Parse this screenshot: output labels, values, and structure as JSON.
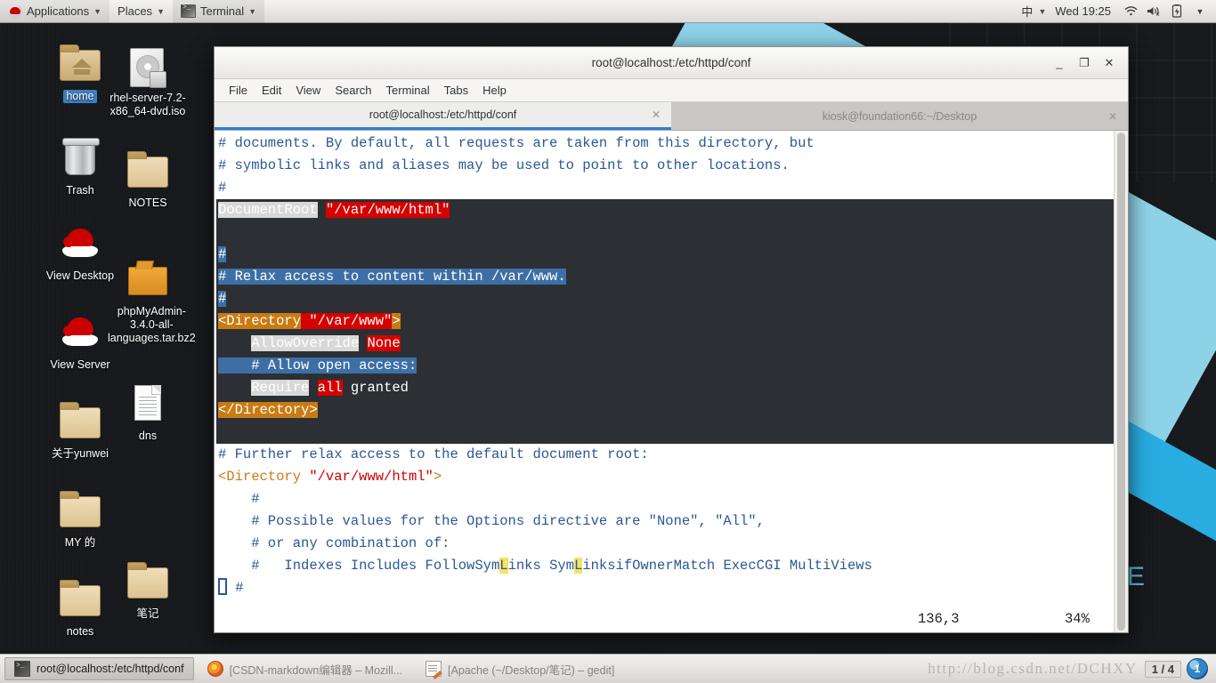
{
  "top_panel": {
    "applications": "Applications",
    "places": "Places",
    "active_app": "Terminal",
    "caret": "▼",
    "ime": "中",
    "clock": "Wed 19:25",
    "icons": {
      "wifi": "wifi-icon",
      "volume": "volume-muted-icon",
      "battery": "battery-icon",
      "menu_caret": "▼"
    }
  },
  "desktop": {
    "wallpaper_text": "SE",
    "icons": [
      {
        "label": "home",
        "type": "folder-home",
        "selected": true
      },
      {
        "label": "rhel-server-7.2-x86_64-dvd.iso",
        "type": "disc"
      },
      {
        "label": "Trash",
        "type": "trash"
      },
      {
        "label": "NOTES",
        "type": "folder"
      },
      {
        "label": "View Desktop",
        "type": "redhat"
      },
      {
        "label": "phpMyAdmin-3.4.0-all-languages.tar.bz2",
        "type": "archive"
      },
      {
        "label": "View Server",
        "type": "redhat"
      },
      {
        "label": "关于yunwei",
        "type": "folder"
      },
      {
        "label": "dns",
        "type": "document"
      },
      {
        "label": "MY 的",
        "type": "folder"
      },
      {
        "label": "笔记",
        "type": "folder"
      },
      {
        "label": "notes",
        "type": "folder"
      }
    ]
  },
  "terminal": {
    "title": "root@localhost:/etc/httpd/conf",
    "window_buttons": {
      "minimize": "_",
      "maximize": "❐",
      "close": "✕"
    },
    "menu": [
      "File",
      "Edit",
      "View",
      "Search",
      "Terminal",
      "Tabs",
      "Help"
    ],
    "tabs": [
      {
        "label": "root@localhost:/etc/httpd/conf",
        "active": true,
        "close": "✕"
      },
      {
        "label": "kiosk@foundation66:~/Desktop",
        "active": false,
        "close": "✕"
      }
    ],
    "status": {
      "position": "136,3",
      "percent": "34%"
    },
    "lines": [
      {
        "bg": "white",
        "segs": [
          {
            "t": "# documents. By default, all requests are taken from this directory, but",
            "s": "fg-blue"
          }
        ]
      },
      {
        "bg": "white",
        "segs": [
          {
            "t": "# symbolic links and aliases may be used to point to other locations.",
            "s": "fg-blue"
          }
        ]
      },
      {
        "bg": "white",
        "segs": [
          {
            "t": "#",
            "s": "fg-blue"
          }
        ]
      },
      {
        "bg": "dark",
        "segs": [
          {
            "t": "DocumentRoot",
            "s": "bg-grey"
          },
          {
            "t": " ",
            "s": "bg-dark"
          },
          {
            "t": "\"/var/www/html\"",
            "s": "bg-red"
          }
        ]
      },
      {
        "bg": "dark",
        "segs": [
          {
            "t": "",
            "s": "bg-dark"
          }
        ]
      },
      {
        "bg": "dark",
        "segs": [
          {
            "t": "#",
            "s": "bg-blue"
          }
        ]
      },
      {
        "bg": "dark",
        "segs": [
          {
            "t": "# Relax access to content within /var/www.",
            "s": "bg-blue"
          }
        ]
      },
      {
        "bg": "dark",
        "segs": [
          {
            "t": "#",
            "s": "bg-blue"
          }
        ]
      },
      {
        "bg": "dark",
        "segs": [
          {
            "t": "<Directory",
            "s": "bg-orange"
          },
          {
            "t": " \"/var/www\"",
            "s": "bg-red"
          },
          {
            "t": ">",
            "s": "bg-orange"
          }
        ]
      },
      {
        "bg": "dark",
        "segs": [
          {
            "t": "    ",
            "s": "bg-dark"
          },
          {
            "t": "AllowOverride",
            "s": "bg-grey"
          },
          {
            "t": " ",
            "s": "bg-dark"
          },
          {
            "t": "None",
            "s": "bg-red"
          }
        ]
      },
      {
        "bg": "dark",
        "segs": [
          {
            "t": "    # Allow open access:",
            "s": "bg-blue"
          }
        ]
      },
      {
        "bg": "dark",
        "segs": [
          {
            "t": "    ",
            "s": "bg-dark"
          },
          {
            "t": "Require",
            "s": "bg-grey"
          },
          {
            "t": " ",
            "s": "bg-dark"
          },
          {
            "t": "all",
            "s": "bg-red"
          },
          {
            "t": " granted",
            "s": "bg-dark fg-white"
          }
        ]
      },
      {
        "bg": "dark",
        "segs": [
          {
            "t": "</Directory>",
            "s": "bg-orange"
          }
        ]
      },
      {
        "bg": "dark",
        "segs": [
          {
            "t": "",
            "s": "bg-dark"
          }
        ]
      },
      {
        "bg": "white",
        "segs": [
          {
            "t": "# Further relax access to the default document root:",
            "s": "fg-blue"
          }
        ]
      },
      {
        "bg": "white",
        "segs": [
          {
            "t": "<Directory",
            "s": "fg-orange"
          },
          {
            "t": " ",
            "s": ""
          },
          {
            "t": "\"/var/www/html\"",
            "s": "fg-red"
          },
          {
            "t": ">",
            "s": "fg-orange"
          }
        ]
      },
      {
        "bg": "white",
        "segs": [
          {
            "t": "    #",
            "s": "fg-blue"
          }
        ]
      },
      {
        "bg": "white",
        "segs": [
          {
            "t": "    # Possible values for the Options directive are \"None\", \"All\",",
            "s": "fg-blue"
          }
        ]
      },
      {
        "bg": "white",
        "segs": [
          {
            "t": "    # or any combination of:",
            "s": "fg-blue"
          }
        ]
      },
      {
        "bg": "white",
        "segs": [
          {
            "t": "    #   Indexes Includes FollowSym",
            "s": "fg-blue"
          },
          {
            "t": "L",
            "s": "bg-yellow"
          },
          {
            "t": "inks Sym",
            "s": "fg-blue"
          },
          {
            "t": "L",
            "s": "bg-yellow"
          },
          {
            "t": "inksifOwnerMatch ExecCGI MultiViews",
            "s": "fg-blue"
          }
        ]
      },
      {
        "bg": "white",
        "cursor": true,
        "segs": [
          {
            "t": " #",
            "s": "fg-blue"
          }
        ]
      }
    ]
  },
  "taskbar": {
    "buttons": [
      {
        "label": "root@localhost:/etc/httpd/conf",
        "icon": "terminal-icon",
        "active": true
      },
      {
        "label": "[CSDN-markdown编辑器 – Mozill...",
        "icon": "firefox-icon",
        "active": false
      },
      {
        "label": "[Apache (~/Desktop/笔记) – gedit]",
        "icon": "gedit-icon",
        "active": false
      }
    ],
    "watermark": "http://blog.csdn.net/DCHXY",
    "workspace_label": "1 / 4",
    "workspace_orb": "1"
  }
}
